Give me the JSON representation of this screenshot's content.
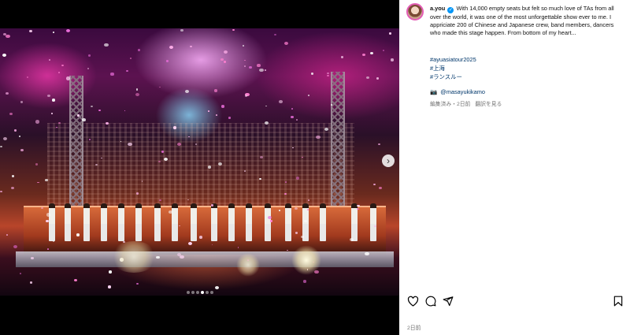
{
  "post": {
    "username": "a.you",
    "verified_icon": "verified-badge-icon",
    "caption": "With 14,000 empty seats but felt so much love of TAs from all over the world, it was one of the most unforgettable show ever to me. I appriciate 200 of Chinese and Japanese crew, band members, dancers who made this stage happen. From bottom of my heart...",
    "hashtags": [
      "#ayuasiatour2025",
      "#上海",
      "#ランスルー"
    ],
    "credit": "@masayukikamo",
    "edited_label": "編集済み・2日前",
    "translation_label": "翻訳を見る",
    "date": "2日前",
    "carousel_slides": 6,
    "carousel_active_index": 3
  },
  "actions": {
    "like": "heart-icon",
    "comment": "comment-icon",
    "share": "send-icon",
    "save": "bookmark-icon"
  },
  "colors": {
    "link": "#00376b",
    "verified": "#0095f6",
    "meta": "#737373"
  }
}
